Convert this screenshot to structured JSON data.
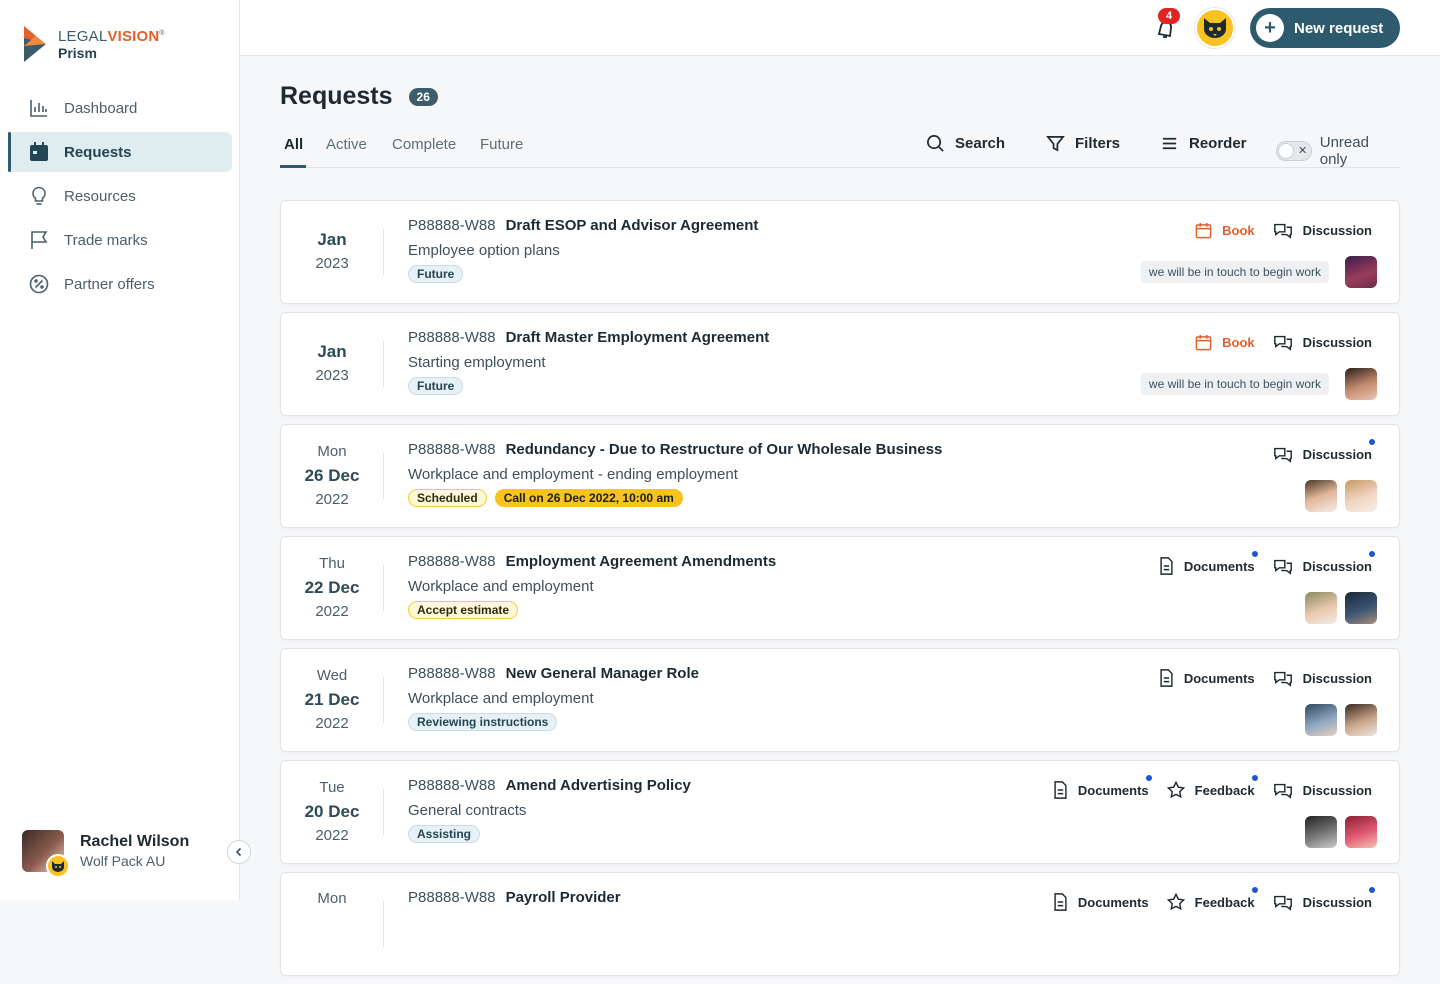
{
  "brand": {
    "top_prefix": "LEGAL",
    "top_accent": "VISION",
    "product": "Prism"
  },
  "nav": [
    {
      "label": "Dashboard",
      "icon": "bar-chart-icon",
      "active": false
    },
    {
      "label": "Requests",
      "icon": "calendar-icon",
      "active": true
    },
    {
      "label": "Resources",
      "icon": "lightbulb-icon",
      "active": false
    },
    {
      "label": "Trade marks",
      "icon": "flag-icon",
      "active": false
    },
    {
      "label": "Partner offers",
      "icon": "discount-badge-icon",
      "active": false
    }
  ],
  "user": {
    "name": "Rachel Wilson",
    "org": "Wolf Pack AU"
  },
  "header": {
    "notifications": "4",
    "new_request_label": "New request"
  },
  "page": {
    "title": "Requests",
    "count": "26"
  },
  "tabs": [
    "All",
    "Active",
    "Complete",
    "Future"
  ],
  "toolbar": {
    "search": "Search",
    "filters": "Filters",
    "reorder": "Reorder",
    "unread_only": "Unread only"
  },
  "colors": {
    "primary": "#2d5a6d",
    "accent": "#e4602b",
    "highlight": "#f8c320",
    "unread_dot": "#1f56d6"
  },
  "requests": [
    {
      "date": [
        "Jan",
        "2023"
      ],
      "ref": "P88888-W88",
      "title": "Draft ESOP and Advisor Agreement",
      "category": "Employee option plans",
      "tags": [
        "Future"
      ],
      "actions": {
        "book": "Book",
        "documents": "",
        "feedback": "",
        "discussion": "Discussion"
      },
      "note": "we will be in touch to begin work"
    },
    {
      "date": [
        "Jan",
        "2023"
      ],
      "ref": "P88888-W88",
      "title": "Draft Master Employment Agreement",
      "category": "Starting employment",
      "tags": [
        "Future"
      ],
      "actions": {
        "book": "Book",
        "documents": "",
        "feedback": "",
        "discussion": "Discussion"
      },
      "note": "we will be in touch to begin work"
    },
    {
      "date": [
        "Mon",
        "26 Dec",
        "2022"
      ],
      "ref": "P88888-W88",
      "title": "Redundancy - Due to Restructure of Our Wholesale Business",
      "category": "Workplace and employment - ending employment",
      "tags": [
        "Scheduled",
        "Call on 26 Dec 2022, 10:00 am"
      ],
      "actions": {
        "discussion": "Discussion"
      }
    },
    {
      "date": [
        "Thu",
        "22 Dec",
        "2022"
      ],
      "ref": "P88888-W88",
      "title": "Employment Agreement Amendments",
      "category": "Workplace and employment",
      "tags": [
        "Accept estimate"
      ],
      "actions": {
        "documents": "Documents",
        "discussion": "Discussion"
      }
    },
    {
      "date": [
        "Wed",
        "21 Dec",
        "2022"
      ],
      "ref": "P88888-W88",
      "title": "New General Manager Role",
      "category": "Workplace and employment",
      "tags": [
        "Reviewing instructions"
      ],
      "actions": {
        "documents": "Documents",
        "discussion": "Discussion"
      }
    },
    {
      "date": [
        "Tue",
        "20 Dec",
        "2022"
      ],
      "ref": "P88888-W88",
      "title": "Amend Advertising Policy",
      "category": "General contracts",
      "tags": [
        "Assisting"
      ],
      "actions": {
        "documents": "Documents",
        "feedback": "Feedback",
        "discussion": "Discussion"
      }
    },
    {
      "date": [
        "Mon"
      ],
      "ref": "P88888-W88",
      "title": "Payroll Provider",
      "category": "",
      "tags": [],
      "actions": {
        "documents": "Documents",
        "feedback": "Feedback",
        "discussion": "Discussion"
      }
    }
  ]
}
